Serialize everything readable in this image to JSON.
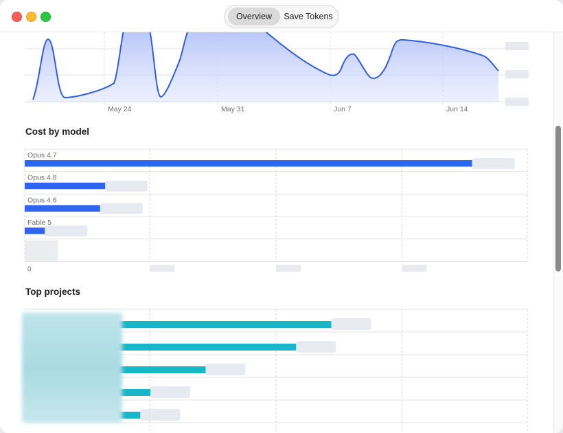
{
  "window": {
    "segments": [
      "Overview",
      "Save Tokens"
    ],
    "active_segment": "Overview"
  },
  "usage_chart": {
    "x_labels": [
      "May 24",
      "May 31",
      "Jun 7",
      "Jun 14"
    ],
    "line_color": "#2f5ee0",
    "fill_color": "#c9d3fb"
  },
  "cost_by_model": {
    "title": "Cost by model",
    "bar_color": "#2d66f5",
    "models": [
      {
        "name": "Opus 4.7",
        "value": 0.89
      },
      {
        "name": "Opus 4.8",
        "value": 0.16
      },
      {
        "name": "Opus 4.6",
        "value": 0.15
      },
      {
        "name": "Fable 5",
        "value": 0.04
      }
    ],
    "x_axis_first_tick": "0"
  },
  "top_projects": {
    "title": "Top projects",
    "bar_color": "#19b6c8",
    "projects": [
      {
        "value": 0.61
      },
      {
        "value": 0.54
      },
      {
        "value": 0.36
      },
      {
        "value": 0.25
      },
      {
        "value": 0.23
      }
    ],
    "last_label": "appletv"
  }
}
